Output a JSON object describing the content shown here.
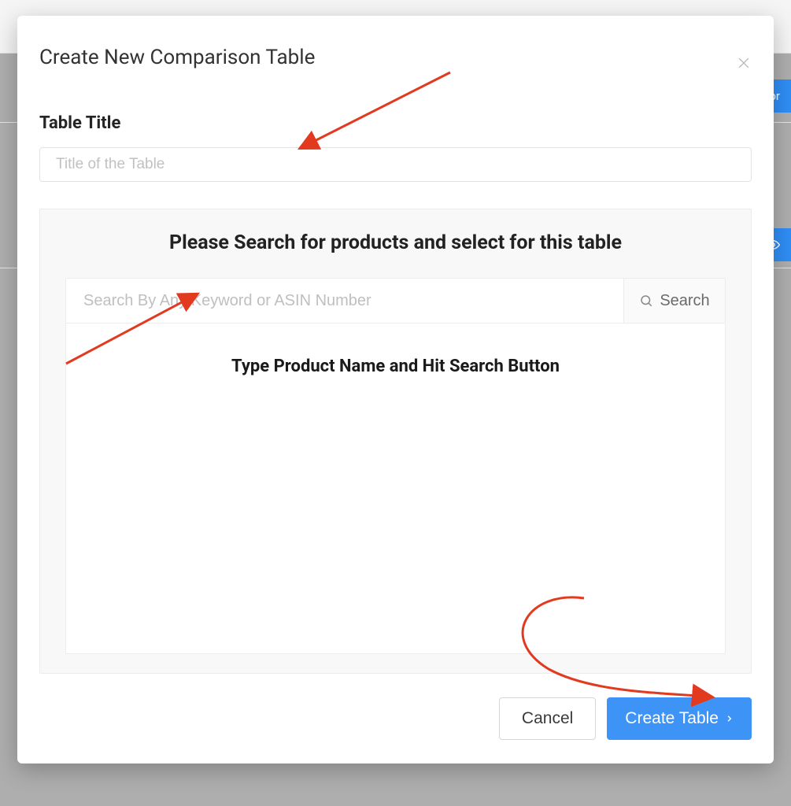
{
  "modal": {
    "title": "Create New Comparison Table",
    "table_title_label": "Table Title",
    "table_title_placeholder": "Title of the Table"
  },
  "search_panel": {
    "heading": "Please Search for products and select for this table",
    "input_placeholder": "Search By Any Keyword or ASIN Number",
    "search_button_label": "Search",
    "results_hint": "Type Product Name and Hit Search Button"
  },
  "footer": {
    "cancel_label": "Cancel",
    "create_label": "Create Table"
  },
  "background": {
    "top_button_fragment": "Cor",
    "bottom_button_fragment": ""
  }
}
